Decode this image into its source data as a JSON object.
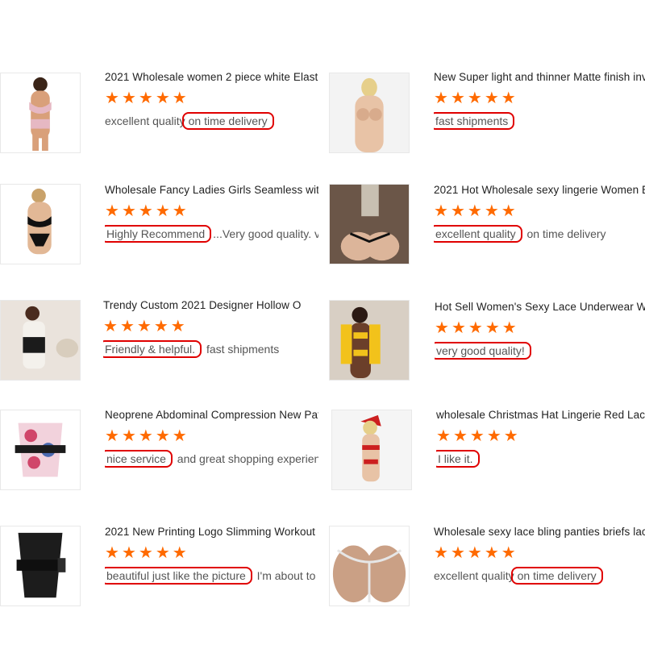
{
  "reviews": [
    {
      "title": "2021 Wholesale women 2 piece white Elastic",
      "pre": "excellent quality",
      "hl": "on time delivery",
      "post": "",
      "stars": 5,
      "thumb": "plus-size-lingerie-pink"
    },
    {
      "title": "New Super light and thinner Matte finish inv",
      "pre": "",
      "hl": "fast shipments",
      "post": "",
      "stars": 5,
      "thumb": "nude-adhesive-bra"
    },
    {
      "title": "Wholesale Fancy Ladies Girls Seamless with",
      "pre": "",
      "hl": "Highly Recommend",
      "post": "...Very good quality. very k",
      "stars": 5,
      "thumb": "black-lace-lingerie"
    },
    {
      "title": "2021 Hot Wholesale sexy lingerie Women E",
      "pre": "",
      "hl": "excellent quality",
      "post": " on time delivery",
      "stars": 5,
      "thumb": "lace-thong-back"
    },
    {
      "title": "Trendy Custom 2021 Designer Hollow O",
      "pre": "",
      "hl": "Friendly & helpful.",
      "post": " fast shipments",
      "stars": 5,
      "thumb": "corset-waist-belt"
    },
    {
      "title": "Hot Sell Women's Sexy Lace Underwear Wo",
      "pre": "",
      "hl": "very good quality!",
      "post": "",
      "stars": 5,
      "thumb": "yellow-lace-set"
    },
    {
      "title": "Neoprene Abdominal Compression New Patte",
      "pre": "",
      "hl": "nice service",
      "post": " and great shopping experience",
      "stars": 5,
      "thumb": "floral-waist-trainer"
    },
    {
      "title": "wholesale Christmas Hat Lingerie Red Lac",
      "pre": "",
      "hl": "I like it.",
      "post": "",
      "stars": 5,
      "thumb": "christmas-lingerie"
    },
    {
      "title": "2021 New Printing Logo Slimming Workout C",
      "pre": "",
      "hl": "beautiful just like the picture",
      "post": " I'm about to orde",
      "stars": 5,
      "thumb": "black-waist-trainer"
    },
    {
      "title": "Wholesale sexy lace bling panties briefs lac",
      "pre": "excellent quality",
      "hl": "on time delivery",
      "post": "",
      "stars": 5,
      "thumb": "rhinestone-thong"
    }
  ],
  "colors": {
    "star": "#ff6a00",
    "highlight_border": "#e00000"
  }
}
